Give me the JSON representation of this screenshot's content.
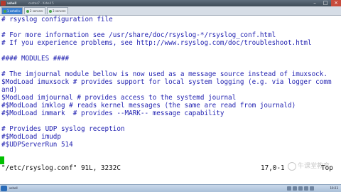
{
  "window": {
    "app_name": "xshell",
    "session_name": "centos7 - Xshell 5",
    "minimize_glyph": "–",
    "maximize_glyph": "□",
    "close_glyph": "×"
  },
  "tabs": [
    {
      "label": "1 xshell"
    },
    {
      "label": "2 server"
    },
    {
      "label": "3 server"
    }
  ],
  "editor": {
    "lines": [
      {
        "text": "# rsyslog configuration file",
        "style": "comment"
      },
      {
        "text": "",
        "style": "normal"
      },
      {
        "text": "# For more information see /usr/share/doc/rsyslog-*/rsyslog_conf.html",
        "style": "comment"
      },
      {
        "text": "# If you experience problems, see http://www.rsyslog.com/doc/troubleshoot.html",
        "style": "comment"
      },
      {
        "text": "",
        "style": "normal"
      },
      {
        "text": "#### MODULES ####",
        "style": "comment"
      },
      {
        "text": "",
        "style": "normal"
      },
      {
        "text": "# The imjournal module bellow is now used as a message source instead of imuxsock.",
        "style": "comment"
      },
      {
        "text": "$ModLoad imuxsock # provides support for local system logging (e.g. via logger comm",
        "style": "comment"
      },
      {
        "text": "and)",
        "style": "comment"
      },
      {
        "text": "$ModLoad imjournal # provides access to the systemd journal",
        "style": "comment"
      },
      {
        "text": "#$ModLoad imklog # reads kernel messages (the same are read from journald)",
        "style": "comment"
      },
      {
        "text": "#$ModLoad immark  # provides --MARK-- message capability",
        "style": "comment"
      },
      {
        "text": "",
        "style": "normal"
      },
      {
        "text": "# Provides UDP syslog reception",
        "style": "comment"
      },
      {
        "text": "#$ModLoad imudp",
        "style": "comment"
      },
      {
        "text": "#$UDPServerRun 514",
        "style": "comment"
      },
      {
        "text": "",
        "style": "normal"
      }
    ],
    "status_file": "\"/etc/rsyslog.conf\" 91L, 3232C",
    "status_position": "17,0-1",
    "status_scroll": "Top"
  },
  "watermark": {
    "text": "牛课堂教育"
  },
  "taskbar": {
    "path_text": "xshell",
    "clock": "10:23"
  }
}
